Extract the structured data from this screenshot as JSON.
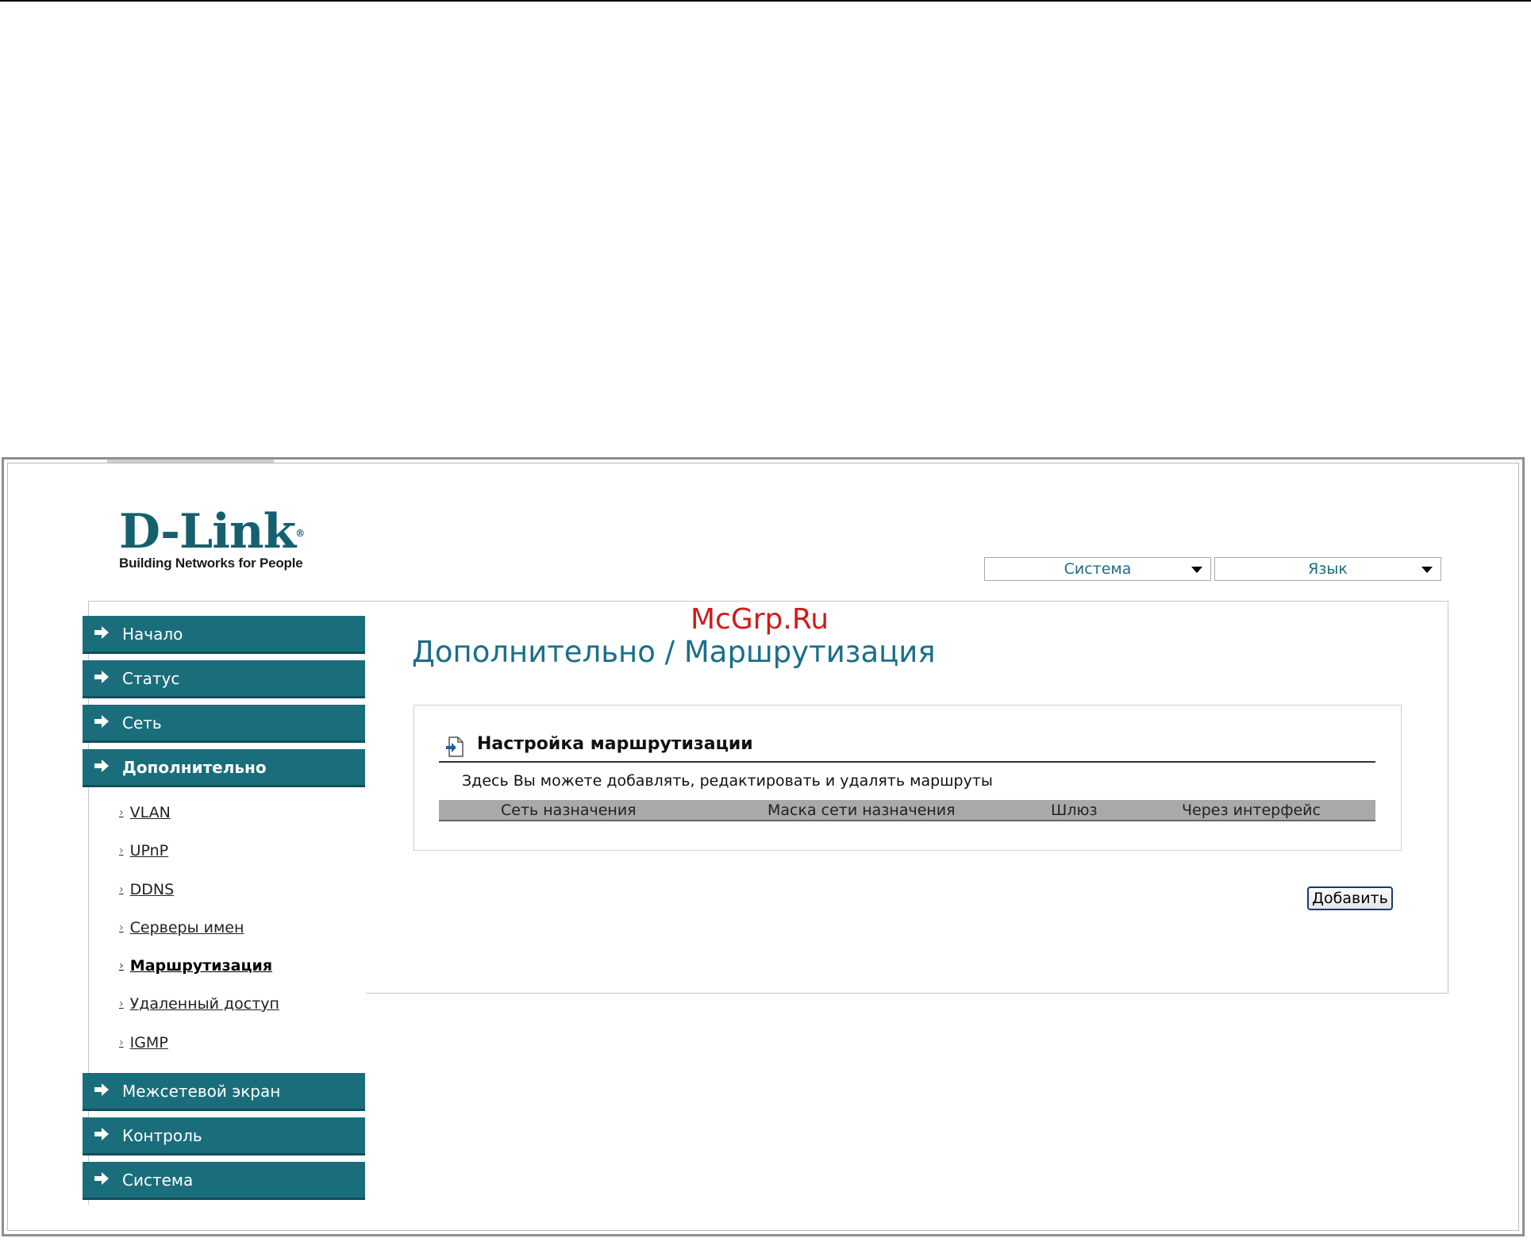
{
  "logo": {
    "brand": "D-Link",
    "reg": "®",
    "tagline": "Building Networks for People"
  },
  "top_selects": {
    "system_label": "Система",
    "language_label": "Язык"
  },
  "watermark": "McGrp.Ru",
  "sidebar": {
    "items": [
      {
        "label": "Начало"
      },
      {
        "label": "Статус"
      },
      {
        "label": "Сеть"
      },
      {
        "label": "Дополнительно"
      },
      {
        "label": "Межсетевой экран"
      },
      {
        "label": "Контроль"
      },
      {
        "label": "Система"
      }
    ],
    "subitems": [
      {
        "label": "VLAN"
      },
      {
        "label": "UPnP"
      },
      {
        "label": "DDNS"
      },
      {
        "label": "Серверы имен"
      },
      {
        "label": "Маршрутизация"
      },
      {
        "label": "Удаленный доступ"
      },
      {
        "label": "IGMP"
      }
    ],
    "bullet": "›"
  },
  "main": {
    "page_title": "Дополнительно /  Маршрутизация",
    "section_title": "Настройка маршрутизации",
    "description": "Здесь Вы можете добавлять, редактировать и удалять маршруты",
    "table": {
      "columns": [
        "Сеть назначения",
        "Маска сети назначения",
        "Шлюз",
        "Через интерфейс"
      ],
      "rows": []
    },
    "add_button": "Добавить"
  },
  "colors": {
    "nav_bg": "#1a6e7c",
    "title": "#1a6e8a",
    "watermark": "#d11b1b",
    "table_header": "#a9a9a9"
  }
}
